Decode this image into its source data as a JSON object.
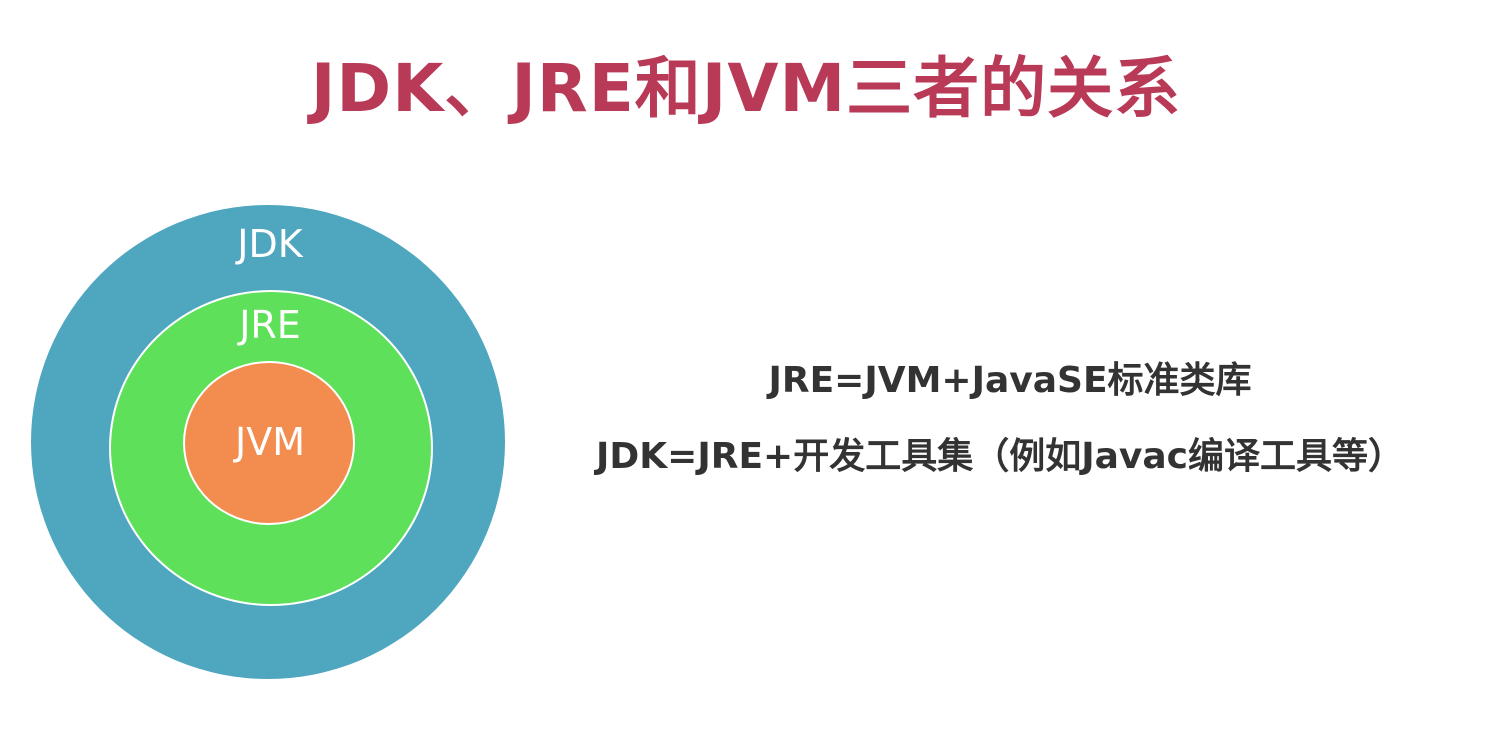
{
  "title": "JDK、JRE和JVM三者的关系",
  "diagram": {
    "circles": [
      {
        "label": "JDK",
        "color": "#4ea6bf"
      },
      {
        "label": "JRE",
        "color": "#5fe05a"
      },
      {
        "label": "JVM",
        "color": "#f38c4f"
      }
    ]
  },
  "formulas": {
    "jre": "JRE=JVM+JavaSE标准类库",
    "jdk": "JDK=JRE+开发工具集（例如Javac编译工具等）"
  }
}
